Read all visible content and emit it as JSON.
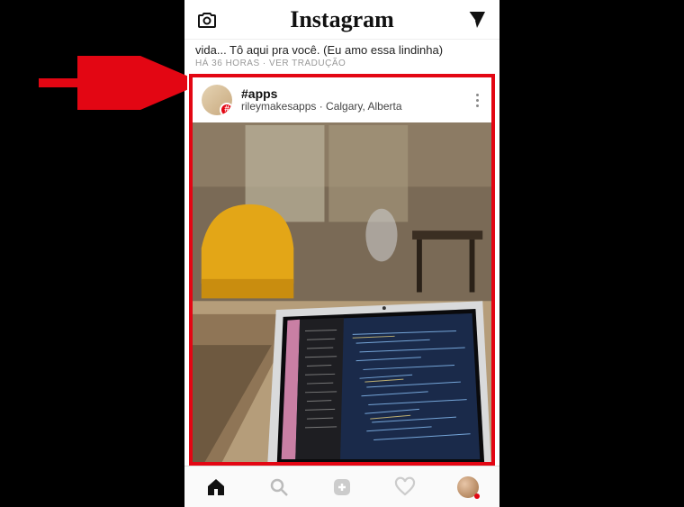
{
  "header": {
    "brand": "Instagram"
  },
  "prev_post": {
    "caption_fragment": "vida... Tô aqui pra você. (Eu amo essa lindinha)",
    "meta_fragment": "HÁ 36 HORAS · VER TRADUÇÃO"
  },
  "post": {
    "hashtag": "#apps",
    "username": "rileymakesapps",
    "location": "Calgary, Alberta",
    "separator": " · ",
    "avatar_badge": "#"
  },
  "annotation": {
    "arrow_color": "#e30613",
    "highlight_color": "#e30613"
  }
}
